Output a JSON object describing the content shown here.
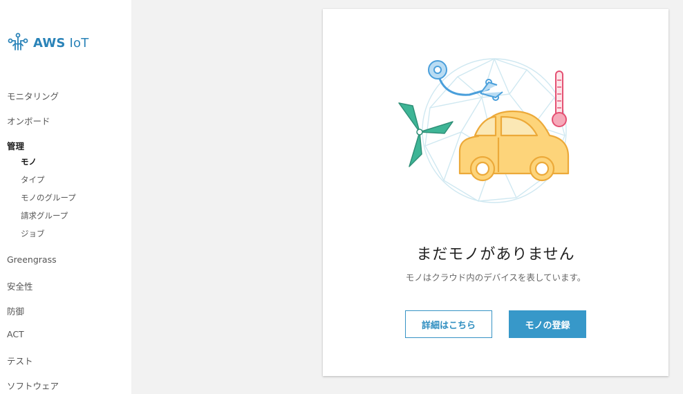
{
  "brand": {
    "name_bold": "AWS",
    "name_rest": "IoT",
    "logo_icon": "aws-iot-logo-icon",
    "color": "#2a83b8"
  },
  "sidebar": {
    "items": [
      {
        "label": "モニタリング"
      },
      {
        "label": "オンボード"
      },
      {
        "label": "管理"
      }
    ],
    "management_sub": [
      {
        "label": "モノ",
        "active": true
      },
      {
        "label": "タイプ"
      },
      {
        "label": "モノのグループ"
      },
      {
        "label": "請求グループ"
      },
      {
        "label": "ジョブ"
      }
    ],
    "items_after": [
      {
        "label": "Greengrass"
      },
      {
        "label": "安全性"
      },
      {
        "label": "防御"
      },
      {
        "label": "ACT"
      },
      {
        "label": "テスト"
      },
      {
        "label": "ソフトウェア"
      }
    ]
  },
  "empty_state": {
    "illustration_icon": "iot-things-illustration-icon",
    "title": "まだモノがありません",
    "subtitle": "モノはクラウド内のデバイスを表しています。",
    "learn_more_label": "詳細はこちら",
    "register_label": "モノの登録"
  },
  "colors": {
    "primary_button": "#3798c9",
    "page_background": "#f2f2f2"
  }
}
